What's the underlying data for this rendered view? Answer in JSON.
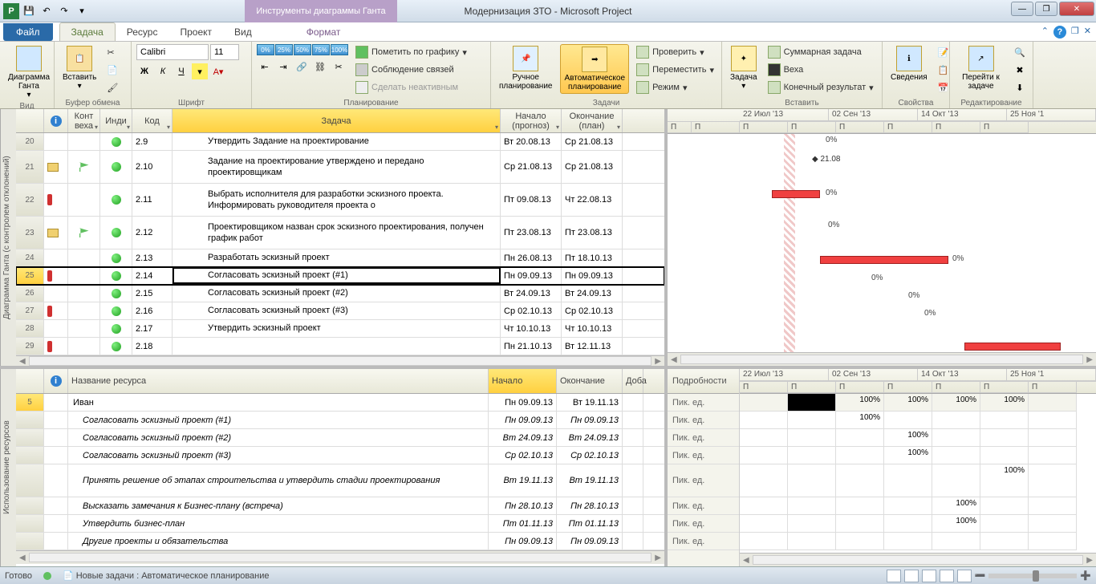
{
  "title": "Модернизация ЗТО  -  Microsoft Project",
  "contextual_tab": "Инструменты диаграммы Ганта",
  "tabs": {
    "file": "Файл",
    "task": "Задача",
    "resource": "Ресурс",
    "project": "Проект",
    "view": "Вид",
    "format": "Формат"
  },
  "ribbon": {
    "groups": {
      "view": "Вид",
      "clipboard": "Буфер обмена",
      "font": "Шрифт",
      "schedule": "Планирование",
      "tasks": "Задачи",
      "insert": "Вставить",
      "properties": "Свойства",
      "editing": "Редактирование"
    },
    "gantt": "Диаграмма Ганта",
    "paste": "Вставить",
    "font_name": "Calibri",
    "font_size": "11",
    "pct": [
      "0%",
      "25%",
      "50%",
      "75%",
      "100%"
    ],
    "mark_track": "Пометить по графику",
    "respect_links": "Соблюдение связей",
    "inactivate": "Сделать неактивным",
    "manual": "Ручное планирование",
    "auto": "Автоматическое планирование",
    "inspect": "Проверить",
    "move": "Переместить",
    "mode": "Режим",
    "task_btn": "Задача",
    "summary": "Суммарная задача",
    "milestone": "Веха",
    "deliverable": "Конечный результат",
    "info": "Сведения",
    "scroll_to": "Перейти к задаче"
  },
  "columns": {
    "row": "",
    "info": "",
    "milestone": "Конт веха",
    "indicator": "Инди",
    "code": "Код",
    "task": "Задача",
    "start": "Начало (прогноз)",
    "finish": "Окончание (план)"
  },
  "rows": [
    {
      "n": "20",
      "code": "2.9",
      "task": "Утвердить Задание на проектирование",
      "start": "Вт 20.08.13",
      "finish": "Ср 21.08.13",
      "ind": "green"
    },
    {
      "n": "21",
      "code": "2.10",
      "task": "Задание на проектирование утверждено и передано проектировщикам",
      "start": "Ср 21.08.13",
      "finish": "Ср 21.08.13",
      "ind": "green",
      "note": true,
      "flag": true,
      "tall": true
    },
    {
      "n": "22",
      "code": "2.11",
      "task": "Выбрать исполнителя для разработки эскизного проекта. Информировать руководителя проекта о",
      "start": "Пт 09.08.13",
      "finish": "Чт 22.08.13",
      "ind": "green",
      "red": true,
      "tall": true
    },
    {
      "n": "23",
      "code": "2.12",
      "task": "Проектировщиком назван срок эскизного проектирования, получен график работ",
      "start": "Пт 23.08.13",
      "finish": "Пт 23.08.13",
      "ind": "green",
      "note": true,
      "flag": true,
      "tall": true
    },
    {
      "n": "24",
      "code": "2.13",
      "task": "Разработать эскизный проект",
      "start": "Пн 26.08.13",
      "finish": "Пт 18.10.13",
      "ind": "green"
    },
    {
      "n": "25",
      "code": "2.14",
      "task": "Согласовать эскизный проект (#1)",
      "start": "Пн 09.09.13",
      "finish": "Пн 09.09.13",
      "ind": "green",
      "red": true,
      "sel": true
    },
    {
      "n": "26",
      "code": "2.15",
      "task": "Согласовать эскизный проект (#2)",
      "start": "Вт 24.09.13",
      "finish": "Вт 24.09.13",
      "ind": "green"
    },
    {
      "n": "27",
      "code": "2.16",
      "task": "Согласовать эскизный проект (#3)",
      "start": "Ср 02.10.13",
      "finish": "Ср 02.10.13",
      "ind": "green",
      "red": true
    },
    {
      "n": "28",
      "code": "2.17",
      "task": "Утвердить эскизный проект",
      "start": "Чт 10.10.13",
      "finish": "Чт 10.10.13",
      "ind": "green"
    },
    {
      "n": "29",
      "code": "2.18",
      "task": "",
      "start": "Пн 21.10.13",
      "finish": "Вт 12.11.13",
      "ind": "green",
      "red": true
    }
  ],
  "timescale": [
    "22 Июл '13",
    "02 Сен '13",
    "14 Окт '13",
    "25 Ноя '1"
  ],
  "timescale_sub": "П",
  "vert_top": "Диаграмма Ганта (с контролем отклонений)",
  "vert_bottom": "Использование ресурсов",
  "detail_hdr": "Подробности",
  "detail_row": "Пик. ед.",
  "bottom_cols": {
    "info": "",
    "name": "Название ресурса",
    "start": "Начало",
    "finish": "Окончание",
    "extra": "Доба"
  },
  "bottom_rows": [
    {
      "n": "5",
      "name": "Иван",
      "start": "Пн 09.09.13",
      "finish": "Вт 19.11.13",
      "italic": false
    },
    {
      "n": "",
      "name": "Согласовать эскизный проект (#1)",
      "start": "Пн 09.09.13",
      "finish": "Пн 09.09.13",
      "italic": true
    },
    {
      "n": "",
      "name": "Согласовать эскизный проект (#2)",
      "start": "Вт 24.09.13",
      "finish": "Вт 24.09.13",
      "italic": true
    },
    {
      "n": "",
      "name": "Согласовать эскизный проект (#3)",
      "start": "Ср 02.10.13",
      "finish": "Ср 02.10.13",
      "italic": true
    },
    {
      "n": "",
      "name": "Принять решение об этапах строительства  и утвердить стадии проектирования",
      "start": "Вт 19.11.13",
      "finish": "Вт 19.11.13",
      "italic": true,
      "tall": true
    },
    {
      "n": "",
      "name": "Высказать замечания к Бизнес-плану (встреча)",
      "start": "Пн 28.10.13",
      "finish": "Пн 28.10.13",
      "italic": true
    },
    {
      "n": "",
      "name": "Утвердить бизнес-план",
      "start": "Пт 01.11.13",
      "finish": "Пт 01.11.13",
      "italic": true
    },
    {
      "n": "",
      "name": "Другие проекты и обязательства",
      "start": "Пн 09.09.13",
      "finish": "Пн 09.09.13",
      "italic": true
    }
  ],
  "usage_vals": [
    [
      "",
      "",
      "100%",
      "100%",
      "100%",
      "100%",
      ""
    ],
    [
      "",
      "",
      "100%",
      "",
      "",
      "",
      ""
    ],
    [
      "",
      "",
      "",
      "100%",
      "",
      "",
      ""
    ],
    [
      "",
      "",
      "",
      "100%",
      "",
      "",
      ""
    ],
    [
      "",
      "",
      "",
      "",
      "",
      "100%",
      ""
    ],
    [
      "",
      "",
      "",
      "",
      "100%",
      "",
      ""
    ],
    [
      "",
      "",
      "",
      "",
      "100%",
      "",
      ""
    ],
    [
      "",
      "",
      "",
      "",
      "",
      "",
      ""
    ]
  ],
  "status": {
    "ready": "Готово",
    "newtasks": "Новые задачи : Автоматическое планирование"
  },
  "gantt_labels": {
    "pct": "0%",
    "milestone": "21.08"
  }
}
